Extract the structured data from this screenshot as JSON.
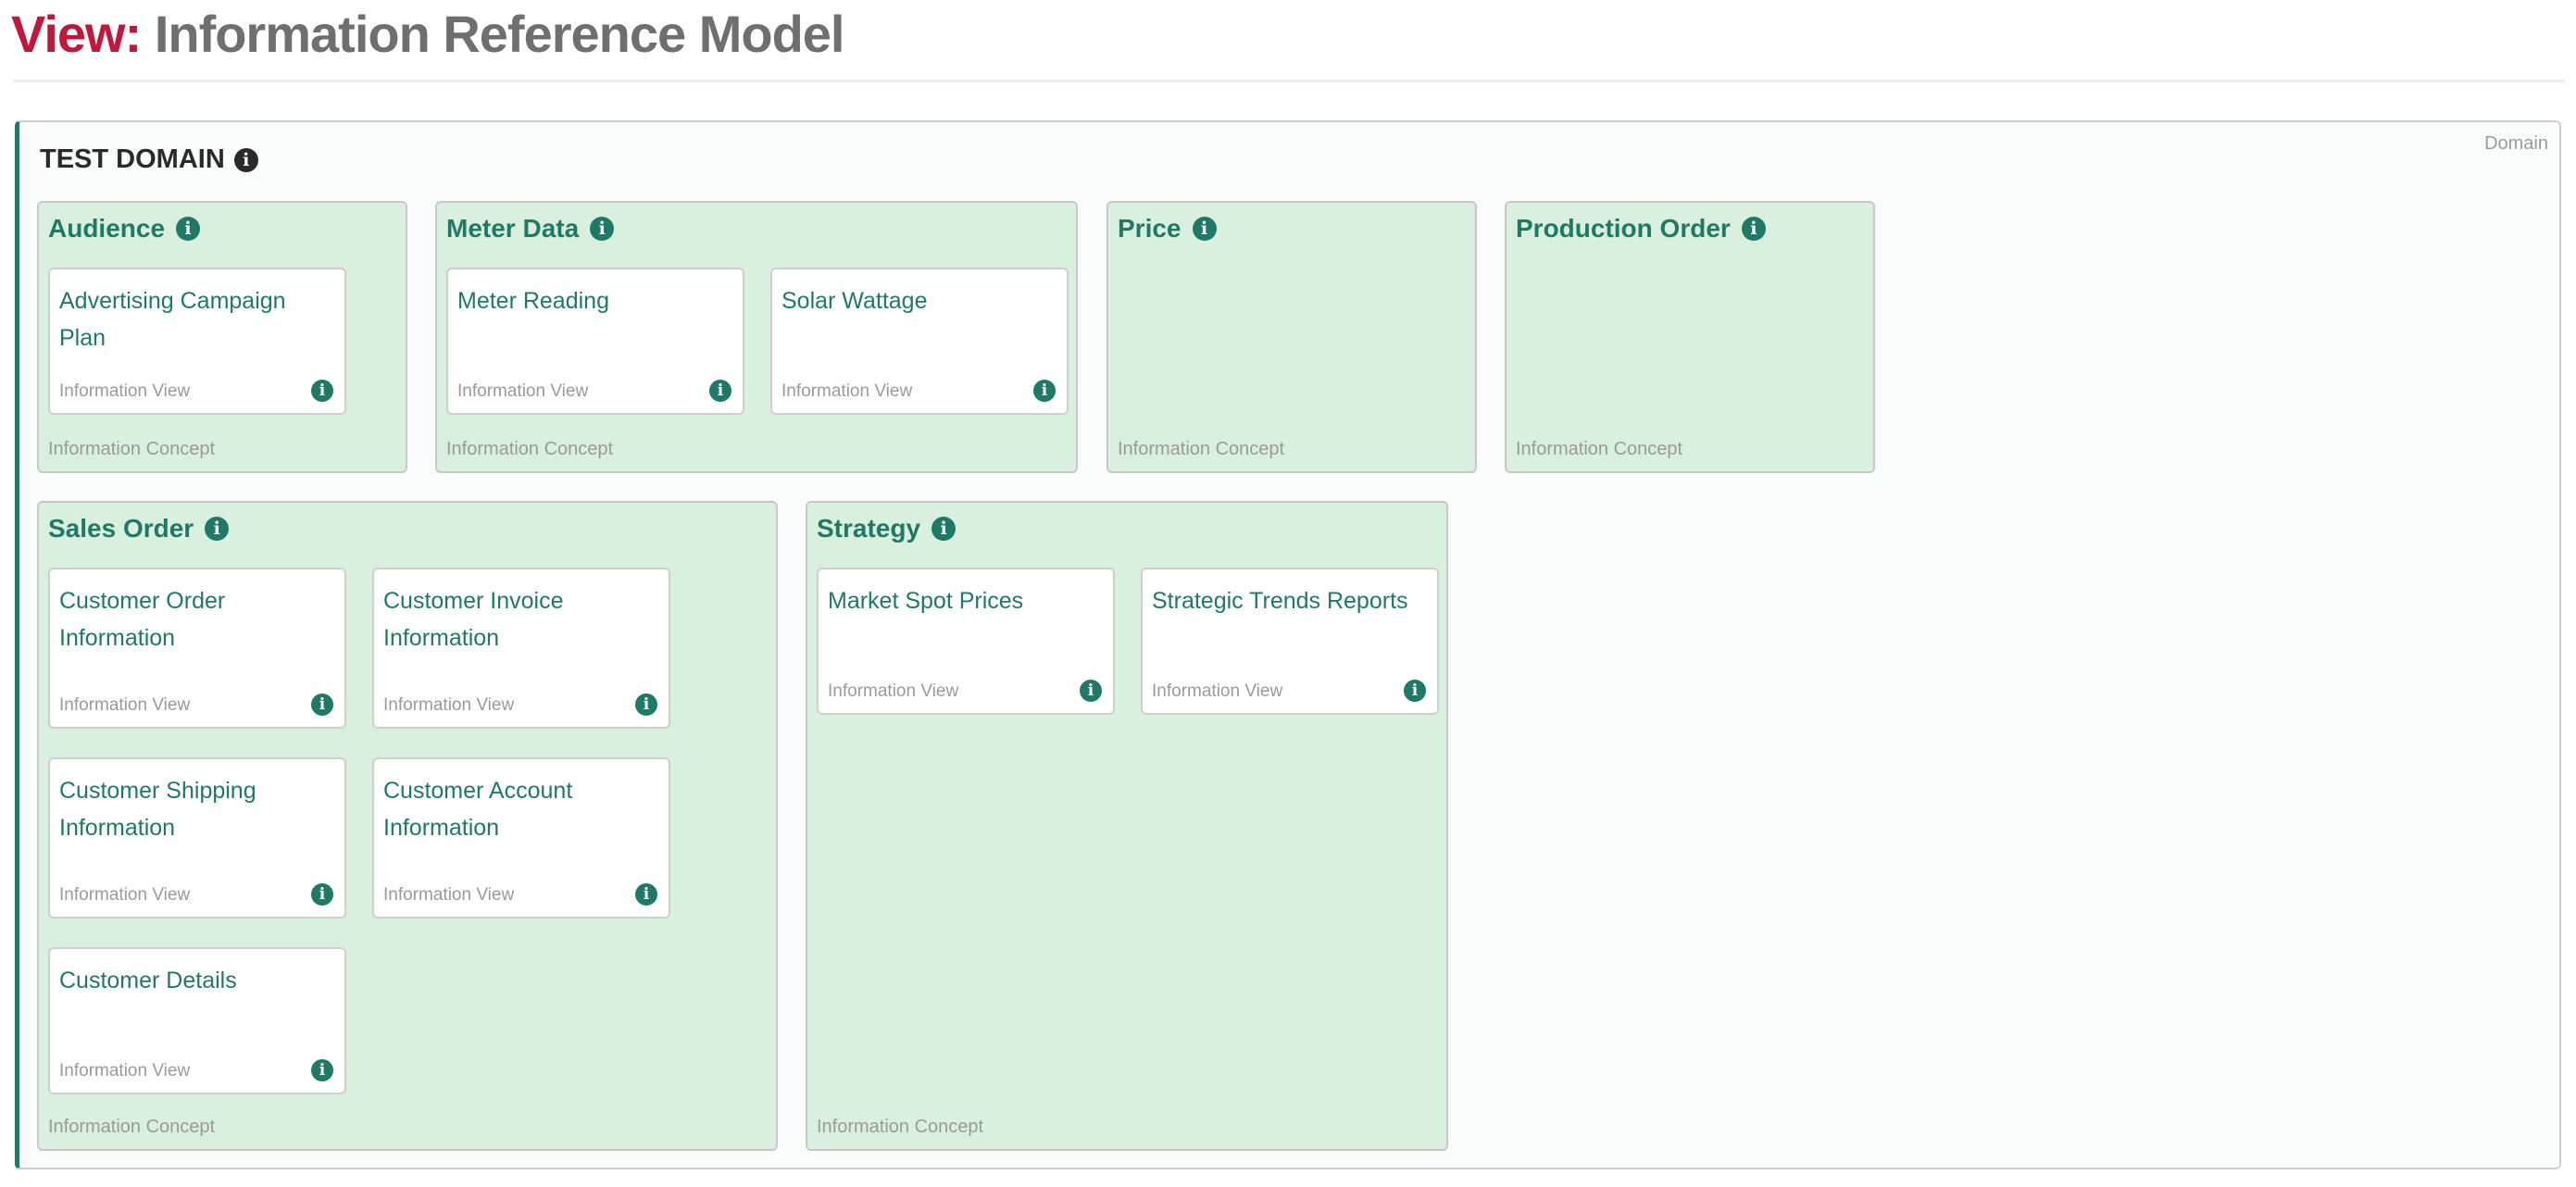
{
  "header": {
    "prefix": "View:",
    "title": "Information Reference Model"
  },
  "domain": {
    "name": "TEST DOMAIN",
    "type_label": "Domain",
    "info_icon": "info-circle-icon"
  },
  "concept_type_label": "Information Concept",
  "view_type_label": "Information View",
  "colors": {
    "accent": "#1e7a66",
    "title_prefix": "#c0173a",
    "title_text": "#6f6f6f",
    "concept_bg": "#d9f0de",
    "muted_text": "#9a9a9a"
  },
  "concepts": [
    {
      "name": "Audience",
      "type": "Information Concept",
      "views": [
        {
          "name": "Advertising Campaign Plan",
          "type": "Information View"
        }
      ]
    },
    {
      "name": "Meter Data",
      "type": "Information Concept",
      "views": [
        {
          "name": "Meter Reading",
          "type": "Information View"
        },
        {
          "name": "Solar Wattage",
          "type": "Information View"
        }
      ]
    },
    {
      "name": "Price",
      "type": "Information Concept",
      "views": []
    },
    {
      "name": "Production Order",
      "type": "Information Concept",
      "views": []
    },
    {
      "name": "Sales Order",
      "type": "Information Concept",
      "views": [
        {
          "name": "Customer Order Information",
          "type": "Information View"
        },
        {
          "name": "Customer Invoice Information",
          "type": "Information View"
        },
        {
          "name": "Customer Shipping Information",
          "type": "Information View"
        },
        {
          "name": "Customer Account Information",
          "type": "Information View"
        },
        {
          "name": "Customer Details",
          "type": "Information View"
        }
      ]
    },
    {
      "name": "Strategy",
      "type": "Information Concept",
      "views": [
        {
          "name": "Market Spot Prices",
          "type": "Information View"
        },
        {
          "name": "Strategic Trends Reports",
          "type": "Information View"
        }
      ]
    }
  ]
}
